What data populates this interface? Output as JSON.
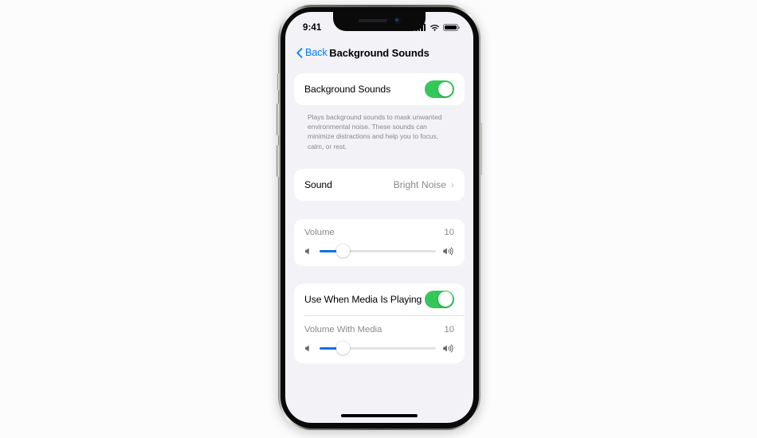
{
  "device": {
    "status_bar": {
      "time": "9:41",
      "cellular_icon": "cellular-bars-icon",
      "wifi_icon": "wifi-icon",
      "battery_icon": "battery-full-icon"
    },
    "home_indicator": "home-indicator"
  },
  "navbar": {
    "back_label": "Back",
    "back_icon": "chevron-left-icon",
    "title": "Background Sounds"
  },
  "sections": {
    "main_toggle": {
      "label": "Background Sounds",
      "toggle_state": "on",
      "footnote": "Plays background sounds to mask unwanted environmental noise. These sounds can minimize distractions and help you to focus, calm, or rest."
    },
    "sound_row": {
      "label": "Sound",
      "value": "Bright Noise",
      "chevron": "›"
    },
    "volume": {
      "label": "Volume",
      "value": "10",
      "percent": 20,
      "low_icon": "speaker-low-icon",
      "high_icon": "speaker-high-icon"
    },
    "media": {
      "toggle_label": "Use When Media Is Playing",
      "toggle_state": "on",
      "slider_label": "Volume With Media",
      "slider_value": "10",
      "percent": 20,
      "low_icon": "speaker-low-icon",
      "high_icon": "speaker-high-icon"
    }
  },
  "colors": {
    "accent_blue": "#007AFF",
    "slider_blue": "#0A72EC",
    "toggle_green": "#34C759",
    "screen_bg": "#F2F2F7",
    "card_bg": "#FFFFFF",
    "secondary_text": "#8A8A8E"
  }
}
